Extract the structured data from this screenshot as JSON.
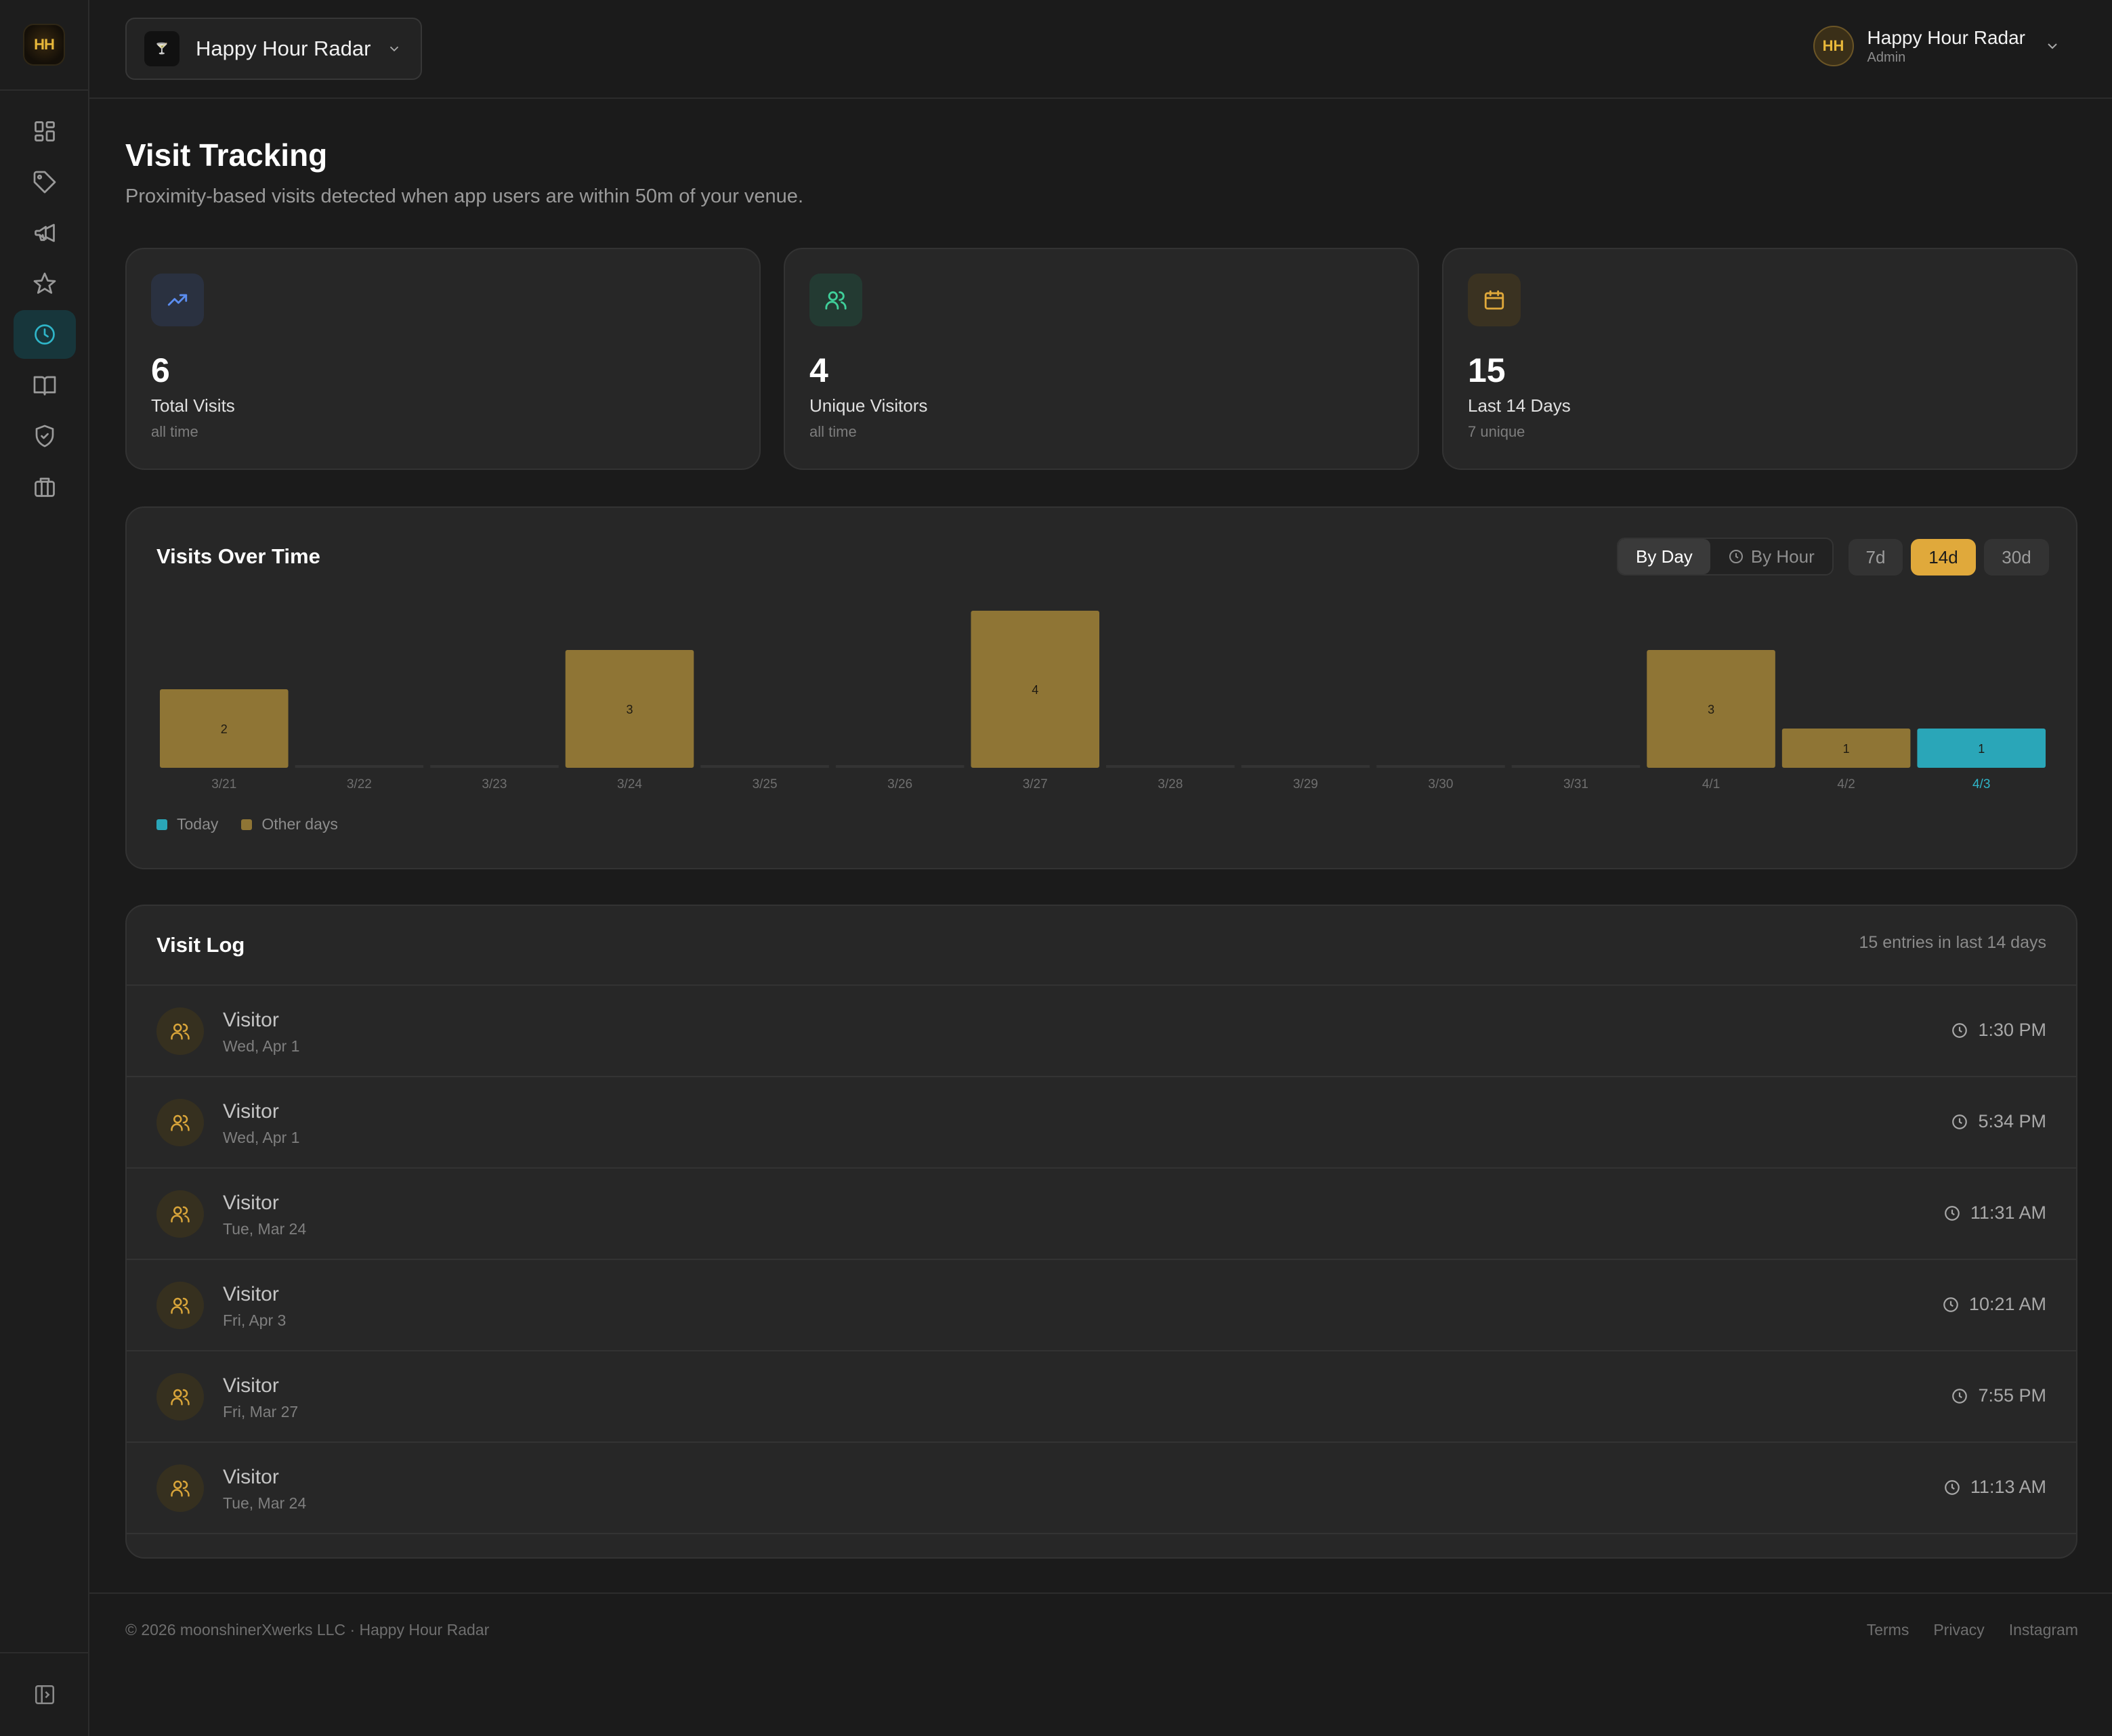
{
  "brand": {
    "logo_text": "HH"
  },
  "venue_selector": {
    "name": "Happy Hour Radar",
    "logo_text": "🍸"
  },
  "user": {
    "initials": "HH",
    "name": "Happy Hour Radar",
    "role": "Admin"
  },
  "sidebar": {
    "items": [
      {
        "icon": "dashboard-icon",
        "active": false
      },
      {
        "icon": "tag-icon",
        "active": false
      },
      {
        "icon": "megaphone-icon",
        "active": false
      },
      {
        "icon": "star-icon",
        "active": false
      },
      {
        "icon": "clock-icon",
        "active": true
      },
      {
        "icon": "book-icon",
        "active": false
      },
      {
        "icon": "shield-check-icon",
        "active": false
      },
      {
        "icon": "briefcase-icon",
        "active": false
      }
    ],
    "collapse_icon": "sidebar-collapse-icon"
  },
  "page": {
    "title": "Visit Tracking",
    "subtitle": "Proximity-based visits detected when app users are within 50m of your venue."
  },
  "stats": [
    {
      "icon": "trending-up-icon",
      "value": "6",
      "label": "Total Visits",
      "note": "all time",
      "color": "#5b8def",
      "bg": "#2a3140"
    },
    {
      "icon": "users-icon",
      "value": "4",
      "label": "Unique Visitors",
      "note": "all time",
      "color": "#3fcf9a",
      "bg": "#233a32"
    },
    {
      "icon": "calendar-icon",
      "value": "15",
      "label": "Last 14 Days",
      "note": "7 unique",
      "color": "#e0a93b",
      "bg": "#3a3221"
    }
  ],
  "chart_card": {
    "title": "Visits Over Time",
    "mode_by_day": "By Day",
    "mode_by_hour": "By Hour",
    "ranges": [
      "7d",
      "14d",
      "30d"
    ],
    "active_range": "14d"
  },
  "chart_data": {
    "type": "bar",
    "categories": [
      "3/21",
      "3/22",
      "3/23",
      "3/24",
      "3/25",
      "3/26",
      "3/27",
      "3/28",
      "3/29",
      "3/30",
      "3/31",
      "4/1",
      "4/2",
      "4/3"
    ],
    "values": [
      2,
      0,
      0,
      3,
      0,
      0,
      4,
      0,
      0,
      0,
      0,
      3,
      1,
      1
    ],
    "highlight_category": "4/3",
    "ylim": [
      0,
      4
    ],
    "grid": false,
    "legend": [
      {
        "label": "Today",
        "color": "#2aa6b8"
      },
      {
        "label": "Other days",
        "color": "#8f7535"
      }
    ],
    "colors": {
      "bar": "#8f7535",
      "today": "#2aa6b8",
      "empty": "#333333"
    }
  },
  "visit_log": {
    "title": "Visit Log",
    "count_text": "15 entries in last 14 days",
    "rows": [
      {
        "name": "Visitor",
        "date": "Wed, Apr 1",
        "time": "1:30 PM"
      },
      {
        "name": "Visitor",
        "date": "Wed, Apr 1",
        "time": "5:34 PM"
      },
      {
        "name": "Visitor",
        "date": "Tue, Mar 24",
        "time": "11:31 AM"
      },
      {
        "name": "Visitor",
        "date": "Fri, Apr 3",
        "time": "10:21 AM"
      },
      {
        "name": "Visitor",
        "date": "Fri, Mar 27",
        "time": "7:55 PM"
      },
      {
        "name": "Visitor",
        "date": "Tue, Mar 24",
        "time": "11:13 AM"
      }
    ]
  },
  "footer": {
    "copyright": "© 2026 moonshinerXwerks LLC · Happy Hour Radar",
    "links": [
      "Terms",
      "Privacy",
      "Instagram"
    ]
  }
}
